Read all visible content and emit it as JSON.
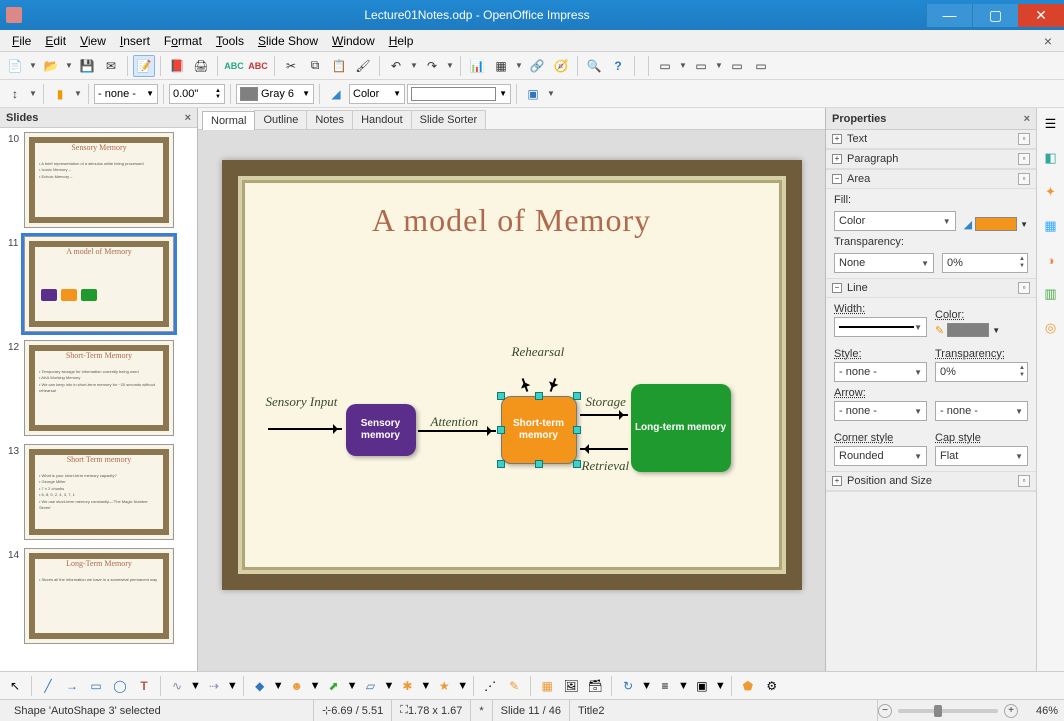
{
  "window": {
    "title": "Lecture01Notes.odp - OpenOffice Impress"
  },
  "menubar": [
    "File",
    "Edit",
    "View",
    "Insert",
    "Format",
    "Tools",
    "Slide Show",
    "Window",
    "Help"
  ],
  "toolbar2": {
    "lineStyle": "- none -",
    "lineWidth": "0.00\"",
    "lineColorName": "Gray 6",
    "fillMode": "Color"
  },
  "viewTabs": [
    "Normal",
    "Outline",
    "Notes",
    "Handout",
    "Slide Sorter"
  ],
  "slidesPanel": {
    "title": "Slides",
    "slides": [
      {
        "num": "10",
        "title": "Sensory Memory",
        "lines": [
          "• A brief representation of a stimulus while being processed",
          "• Iconic Memory –",
          "• Echoic Memory –"
        ]
      },
      {
        "num": "11",
        "title": "A model of Memory",
        "diagram": true
      },
      {
        "num": "12",
        "title": "Short-Term Memory",
        "lines": [
          "• Temporary storage for information currently being used",
          "• AKA Working Memory",
          "• We can keep info in short-term memory for ~20 seconds without rehearsal"
        ]
      },
      {
        "num": "13",
        "title": "Short Term memory",
        "lines": [
          "• What is your short-term memory capacity?",
          "• George Miller",
          "  • 7 ± 2 chunks",
          "  • 6, 8, 9, 2, 4, 3, 7, 1",
          "• We use short-term memory constantly—'The Magic Number Seven'"
        ]
      },
      {
        "num": "14",
        "title": "Long-Term Memory",
        "lines": [
          "• Stores all the information we have in a somewhat permanent way"
        ]
      }
    ],
    "selected": 1
  },
  "slide": {
    "title": "A model of Memory",
    "labels": {
      "sensoryInput": "Sensory Input",
      "attention": "Attention",
      "rehearsal": "Rehearsal",
      "storage": "Storage",
      "retrieval": "Retrieval"
    },
    "boxes": {
      "sensory": "Sensory\nmemory",
      "short": "Short-term\nmemory",
      "long": "Long-term\nmemory"
    }
  },
  "properties": {
    "title": "Properties",
    "sections": {
      "text": "Text",
      "paragraph": "Paragraph",
      "area": "Area",
      "line": "Line",
      "position": "Position and Size"
    },
    "area": {
      "fillLabel": "Fill:",
      "fillMode": "Color",
      "fillColor": "#f2951a",
      "transparencyLabel": "Transparency:",
      "transparencyMode": "None",
      "transparencyValue": "0%"
    },
    "line": {
      "widthLabel": "Width:",
      "colorLabel": "Color:",
      "lineColor": "#808080",
      "styleLabel": "Style:",
      "styleValue": "- none -",
      "transparencyLabel": "Transparency:",
      "transparencyValue": "0%",
      "arrowLabel": "Arrow:",
      "arrowStart": "- none -",
      "arrowEnd": "- none -",
      "cornerLabel": "Corner style",
      "cornerValue": "Rounded",
      "capLabel": "Cap style",
      "capValue": "Flat"
    }
  },
  "status": {
    "selection": "Shape 'AutoShape 3' selected",
    "pos": "6.69 / 5.51",
    "size": "1.78 x 1.67",
    "modified": "*",
    "slide": "Slide 11 / 46",
    "layout": "Title2",
    "zoom": "46%"
  }
}
